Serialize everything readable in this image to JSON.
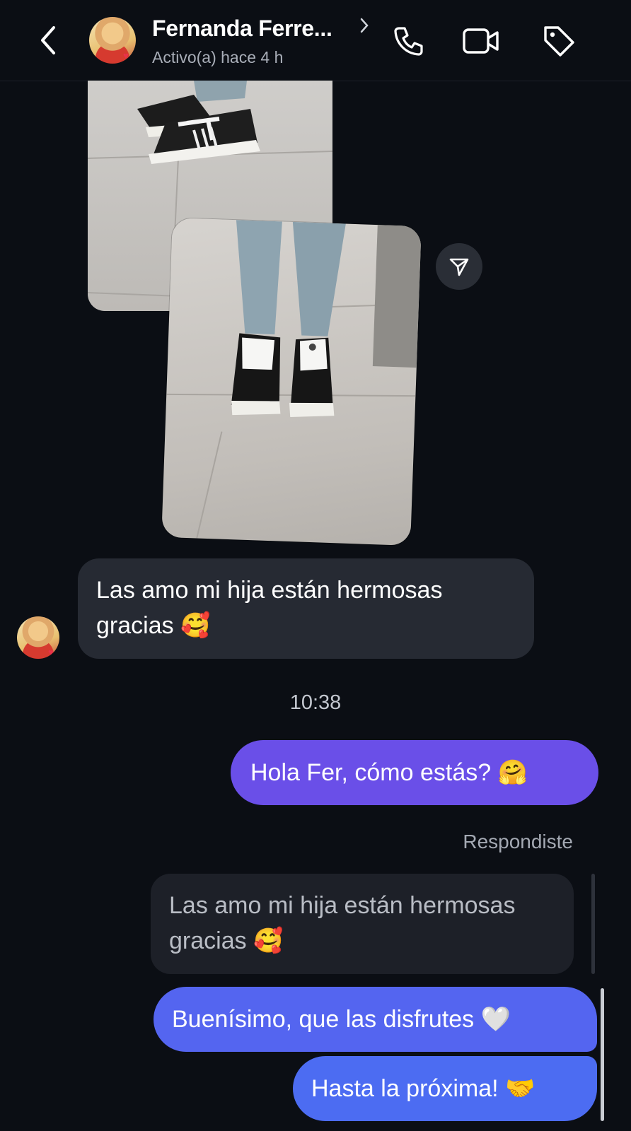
{
  "header": {
    "contact_name": "Fernanda Ferre...",
    "status": "Activo(a) hace 4 h",
    "icons": [
      "chevron-left-icon",
      "chevron-right-icon",
      "phone-icon",
      "video-camera-icon",
      "tag-icon"
    ]
  },
  "messages": {
    "incoming_text": "Las amo mi hija están hermosas gracias",
    "incoming_emoji": "🥰",
    "timestamp": "10:38",
    "outgoing_1_text": "Hola Fer, cómo estás?",
    "outgoing_1_emoji": "🤗",
    "replied_label": "Respondiste",
    "quoted_text": "Las amo mi hija están hermosas gracias",
    "quoted_emoji": "🥰",
    "outgoing_2_text": "Buenísimo, que las disfrutes",
    "outgoing_2_emoji": "🤍",
    "outgoing_3_text": "Hasta la próxima!",
    "outgoing_3_emoji": "🤝"
  },
  "colors": {
    "background": "#0b0e14",
    "incoming_bubble": "#262a33",
    "outgoing_purple": "#6a4fe8",
    "outgoing_blue": "#5465f0"
  }
}
